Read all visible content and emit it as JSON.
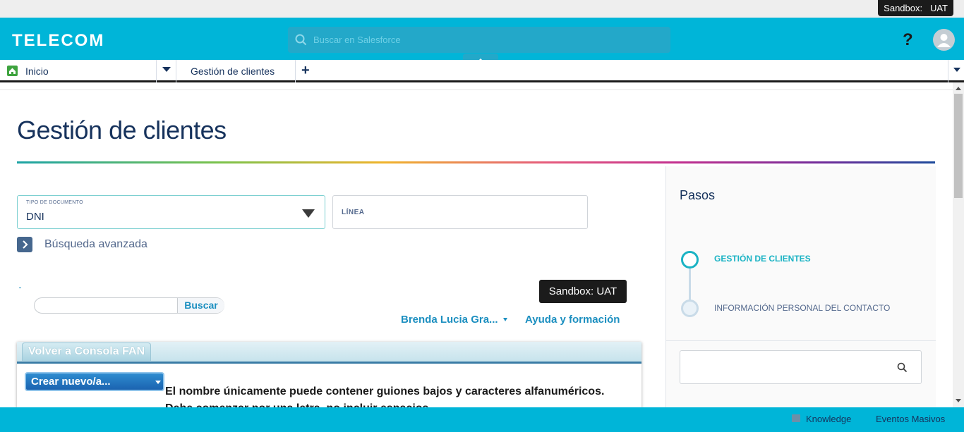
{
  "environment": {
    "sandbox_label": "Sandbox:",
    "sandbox_name": "UAT"
  },
  "header": {
    "brand": "TELECOM",
    "search_placeholder": "Buscar en Salesforce",
    "help_label": "?"
  },
  "tabs": {
    "home_label": "Inicio",
    "active_label": "Gestión de clientes",
    "add_label": "+"
  },
  "page": {
    "title": "Gestión de clientes"
  },
  "form": {
    "doc_type_label": "TIPO DE DOCUMENTO",
    "doc_type_value": "DNI",
    "line_label": "LÍNEA",
    "advanced_search_label": "Búsqueda avanzada"
  },
  "embedded": {
    "search_button": "Buscar",
    "sandbox_badge": "Sandbox:  UAT",
    "user_name": "Brenda Lucia Gra...",
    "help_link": "Ayuda y formación",
    "panel_tab": "Volver a Consola FAN",
    "create_button": "Crear nuevo/a...",
    "message_line1": "El nombre únicamente puede contener guiones bajos y caracteres alfanuméricos.",
    "message_line2": "Debe comenzar por una letra, no incluir espacios..."
  },
  "sidebar": {
    "title": "Pasos",
    "steps": [
      {
        "label": "GESTIÓN DE CLIENTES",
        "state": "active"
      },
      {
        "label": "INFORMACIÓN PERSONAL DEL CONTACTO",
        "state": "pending"
      }
    ]
  },
  "footer": {
    "items": [
      {
        "label": "Knowledge",
        "icon": "book-icon"
      },
      {
        "label": "Eventos Masivos"
      }
    ]
  },
  "colors": {
    "brand": "#00b5d8",
    "accent_step": "#1ab3c4",
    "link": "#1c8fc0",
    "title_text": "#16325c"
  }
}
